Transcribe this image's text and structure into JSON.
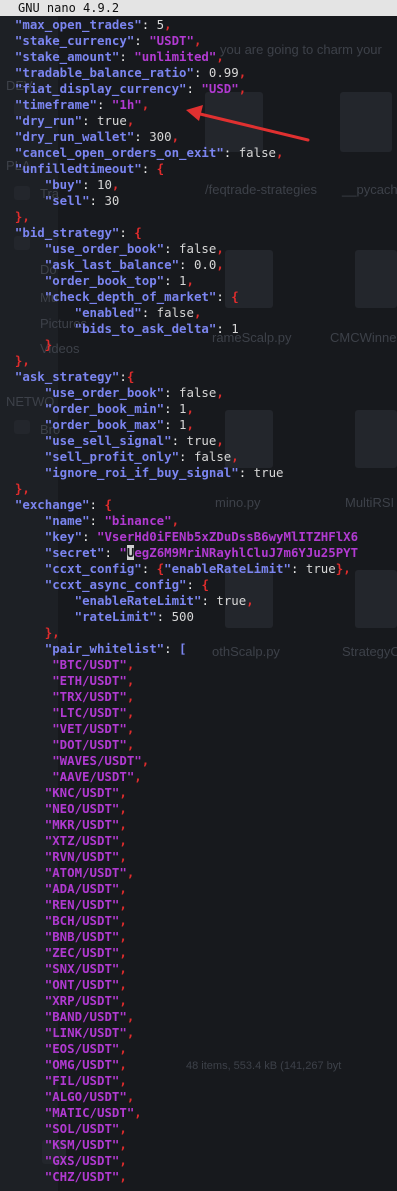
{
  "window": {
    "title": "GNU nano 4.9.2"
  },
  "background_labels": {
    "dev": "DEV",
    "places": "PLA",
    "network": "NETWO",
    "sidebar_items": [
      "Tra",
      "Do",
      "Mu",
      "Pictures",
      "Videos",
      "Bro"
    ],
    "file_names": [
      "/feqtrade-strategies",
      "__pycach",
      "rameScalp.py",
      "CMCWinne",
      "mino.py",
      "MultiRSI",
      "othScalp.py",
      "StrategyC"
    ],
    "status_text": "48 items, 553.4 kB (141,267 byt",
    "banner": "you are going to charm your"
  },
  "annotation": {
    "type": "red-arrow",
    "target": "timeframe line",
    "color": "#e03030"
  },
  "code": {
    "lines": [
      [
        {
          "t": "  "
        },
        {
          "t": "\"max_open_trades\"",
          "c": "k"
        },
        {
          "t": ": ",
          "c": "o"
        },
        {
          "t": "5",
          "c": "v"
        },
        {
          "t": ",",
          "c": "p"
        }
      ],
      [
        {
          "t": "  "
        },
        {
          "t": "\"stake_currency\"",
          "c": "k"
        },
        {
          "t": ": ",
          "c": "o"
        },
        {
          "t": "\"USDT\"",
          "c": "s"
        },
        {
          "t": ",",
          "c": "p"
        }
      ],
      [
        {
          "t": "  "
        },
        {
          "t": "\"stake_amount\"",
          "c": "k"
        },
        {
          "t": ": ",
          "c": "o"
        },
        {
          "t": "\"unlimited\"",
          "c": "s"
        },
        {
          "t": ",",
          "c": "p"
        }
      ],
      [
        {
          "t": "  "
        },
        {
          "t": "\"tradable_balance_ratio\"",
          "c": "k"
        },
        {
          "t": ": ",
          "c": "o"
        },
        {
          "t": "0.99",
          "c": "v"
        },
        {
          "t": ",",
          "c": "p"
        }
      ],
      [
        {
          "t": "  "
        },
        {
          "t": "\"fiat_display_currency\"",
          "c": "k"
        },
        {
          "t": ": ",
          "c": "o"
        },
        {
          "t": "\"USD\"",
          "c": "s"
        },
        {
          "t": ",",
          "c": "p"
        }
      ],
      [
        {
          "t": "  "
        },
        {
          "t": "\"timeframe\"",
          "c": "k"
        },
        {
          "t": ": ",
          "c": "o"
        },
        {
          "t": "\"1h\"",
          "c": "s"
        },
        {
          "t": ",",
          "c": "p"
        }
      ],
      [
        {
          "t": "  "
        },
        {
          "t": "\"dry_run\"",
          "c": "k"
        },
        {
          "t": ": ",
          "c": "o"
        },
        {
          "t": "true",
          "c": "v"
        },
        {
          "t": ",",
          "c": "p"
        }
      ],
      [
        {
          "t": "  "
        },
        {
          "t": "\"dry_run_wallet\"",
          "c": "k"
        },
        {
          "t": ": ",
          "c": "o"
        },
        {
          "t": "300",
          "c": "v"
        },
        {
          "t": ",",
          "c": "p"
        }
      ],
      [
        {
          "t": "  "
        },
        {
          "t": "\"cancel_open_orders_on_exit\"",
          "c": "k"
        },
        {
          "t": ": ",
          "c": "o"
        },
        {
          "t": "false",
          "c": "v"
        },
        {
          "t": ",",
          "c": "p"
        }
      ],
      [
        {
          "t": "  "
        },
        {
          "t": "\"unfilledtimeout\"",
          "c": "k"
        },
        {
          "t": ": ",
          "c": "o"
        },
        {
          "t": "{",
          "c": "p"
        }
      ],
      [
        {
          "t": "      "
        },
        {
          "t": "\"buy\"",
          "c": "k"
        },
        {
          "t": ": ",
          "c": "o"
        },
        {
          "t": "10",
          "c": "v"
        },
        {
          "t": ",",
          "c": "p"
        }
      ],
      [
        {
          "t": "      "
        },
        {
          "t": "\"sell\"",
          "c": "k"
        },
        {
          "t": ": ",
          "c": "o"
        },
        {
          "t": "30",
          "c": "v"
        }
      ],
      [
        {
          "t": "  "
        },
        {
          "t": "},",
          "c": "p"
        }
      ],
      [
        {
          "t": "  "
        },
        {
          "t": "\"bid_strategy\"",
          "c": "k"
        },
        {
          "t": ": ",
          "c": "o"
        },
        {
          "t": "{",
          "c": "p"
        }
      ],
      [
        {
          "t": "      "
        },
        {
          "t": "\"use_order_book\"",
          "c": "k"
        },
        {
          "t": ": ",
          "c": "o"
        },
        {
          "t": "false",
          "c": "v"
        },
        {
          "t": ",",
          "c": "p"
        }
      ],
      [
        {
          "t": "      "
        },
        {
          "t": "\"ask_last_balance\"",
          "c": "k"
        },
        {
          "t": ": ",
          "c": "o"
        },
        {
          "t": "0.0",
          "c": "v"
        },
        {
          "t": ",",
          "c": "p"
        }
      ],
      [
        {
          "t": "      "
        },
        {
          "t": "\"order_book_top\"",
          "c": "k"
        },
        {
          "t": ": ",
          "c": "o"
        },
        {
          "t": "1",
          "c": "v"
        },
        {
          "t": ",",
          "c": "p"
        }
      ],
      [
        {
          "t": "      "
        },
        {
          "t": "\"check_depth_of_market\"",
          "c": "k"
        },
        {
          "t": ": ",
          "c": "o"
        },
        {
          "t": "{",
          "c": "p"
        }
      ],
      [
        {
          "t": "          "
        },
        {
          "t": "\"enabled\"",
          "c": "k"
        },
        {
          "t": ": ",
          "c": "o"
        },
        {
          "t": "false",
          "c": "v"
        },
        {
          "t": ",",
          "c": "p"
        }
      ],
      [
        {
          "t": "          "
        },
        {
          "t": "\"bids_to_ask_delta\"",
          "c": "k"
        },
        {
          "t": ": ",
          "c": "o"
        },
        {
          "t": "1",
          "c": "v"
        }
      ],
      [
        {
          "t": "      "
        },
        {
          "t": "}",
          "c": "p"
        }
      ],
      [
        {
          "t": "  "
        },
        {
          "t": "},",
          "c": "p"
        }
      ],
      [
        {
          "t": "  "
        },
        {
          "t": "\"ask_strategy\"",
          "c": "k"
        },
        {
          "t": ":",
          "c": "o"
        },
        {
          "t": "{",
          "c": "p"
        }
      ],
      [
        {
          "t": "      "
        },
        {
          "t": "\"use_order_book\"",
          "c": "k"
        },
        {
          "t": ": ",
          "c": "o"
        },
        {
          "t": "false",
          "c": "v"
        },
        {
          "t": ",",
          "c": "p"
        }
      ],
      [
        {
          "t": "      "
        },
        {
          "t": "\"order_book_min\"",
          "c": "k"
        },
        {
          "t": ": ",
          "c": "o"
        },
        {
          "t": "1",
          "c": "v"
        },
        {
          "t": ",",
          "c": "p"
        }
      ],
      [
        {
          "t": "      "
        },
        {
          "t": "\"order_book_max\"",
          "c": "k"
        },
        {
          "t": ": ",
          "c": "o"
        },
        {
          "t": "1",
          "c": "v"
        },
        {
          "t": ",",
          "c": "p"
        }
      ],
      [
        {
          "t": "      "
        },
        {
          "t": "\"use_sell_signal\"",
          "c": "k"
        },
        {
          "t": ": ",
          "c": "o"
        },
        {
          "t": "true",
          "c": "v"
        },
        {
          "t": ",",
          "c": "p"
        }
      ],
      [
        {
          "t": "      "
        },
        {
          "t": "\"sell_profit_only\"",
          "c": "k"
        },
        {
          "t": ": ",
          "c": "o"
        },
        {
          "t": "false",
          "c": "v"
        },
        {
          "t": ",",
          "c": "p"
        }
      ],
      [
        {
          "t": "      "
        },
        {
          "t": "\"ignore_roi_if_buy_signal\"",
          "c": "k"
        },
        {
          "t": ": ",
          "c": "o"
        },
        {
          "t": "true",
          "c": "v"
        }
      ],
      [
        {
          "t": "  "
        },
        {
          "t": "},",
          "c": "p"
        }
      ],
      [
        {
          "t": "  "
        },
        {
          "t": "\"exchange\"",
          "c": "k"
        },
        {
          "t": ": ",
          "c": "o"
        },
        {
          "t": "{",
          "c": "p"
        }
      ],
      [
        {
          "t": "      "
        },
        {
          "t": "\"name\"",
          "c": "k"
        },
        {
          "t": ": ",
          "c": "o"
        },
        {
          "t": "\"binance\"",
          "c": "s"
        },
        {
          "t": ",",
          "c": "p"
        }
      ],
      [
        {
          "t": "      "
        },
        {
          "t": "\"key\"",
          "c": "k"
        },
        {
          "t": ": ",
          "c": "o"
        },
        {
          "t": "\"VserHd0iFENb5xZDuDssB6wyMlITZHFlX6",
          "c": "s"
        }
      ],
      [
        {
          "t": "      "
        },
        {
          "t": "\"secret\"",
          "c": "k"
        },
        {
          "t": ": ",
          "c": "o"
        },
        {
          "t": "\"",
          "c": "s"
        },
        {
          "t": "U",
          "c": "s",
          "hl": true
        },
        {
          "t": "egZ6M9MriNRayhlCluJ7m6YJu25PYT",
          "c": "s"
        }
      ],
      [
        {
          "t": "      "
        },
        {
          "t": "\"ccxt_config\"",
          "c": "k"
        },
        {
          "t": ": ",
          "c": "o"
        },
        {
          "t": "{",
          "c": "p"
        },
        {
          "t": "\"enableRateLimit\"",
          "c": "k"
        },
        {
          "t": ": ",
          "c": "o"
        },
        {
          "t": "true",
          "c": "v"
        },
        {
          "t": "},",
          "c": "p"
        }
      ],
      [
        {
          "t": "      "
        },
        {
          "t": "\"ccxt_async_config\"",
          "c": "k"
        },
        {
          "t": ": ",
          "c": "o"
        },
        {
          "t": "{",
          "c": "p"
        }
      ],
      [
        {
          "t": "          "
        },
        {
          "t": "\"enableRateLimit\"",
          "c": "k"
        },
        {
          "t": ": ",
          "c": "o"
        },
        {
          "t": "true",
          "c": "v"
        },
        {
          "t": ",",
          "c": "p"
        }
      ],
      [
        {
          "t": "          "
        },
        {
          "t": "\"rateLimit\"",
          "c": "k"
        },
        {
          "t": ": ",
          "c": "o"
        },
        {
          "t": "500",
          "c": "v"
        }
      ],
      [
        {
          "t": "      "
        },
        {
          "t": "},",
          "c": "p"
        }
      ],
      [
        {
          "t": "      "
        },
        {
          "t": "\"pair_whitelist\"",
          "c": "k"
        },
        {
          "t": ": ",
          "c": "o"
        },
        {
          "t": "[",
          "c": "k"
        }
      ],
      [
        {
          "t": "       "
        },
        {
          "t": "\"BTC/USDT\"",
          "c": "s"
        },
        {
          "t": ",",
          "c": "p"
        }
      ],
      [
        {
          "t": "       "
        },
        {
          "t": "\"ETH/USDT\"",
          "c": "s"
        },
        {
          "t": ",",
          "c": "p"
        }
      ],
      [
        {
          "t": "       "
        },
        {
          "t": "\"TRX/USDT\"",
          "c": "s"
        },
        {
          "t": ",",
          "c": "p"
        }
      ],
      [
        {
          "t": "       "
        },
        {
          "t": "\"LTC/USDT\"",
          "c": "s"
        },
        {
          "t": ",",
          "c": "p"
        }
      ],
      [
        {
          "t": "       "
        },
        {
          "t": "\"VET/USDT\"",
          "c": "s"
        },
        {
          "t": ",",
          "c": "p"
        }
      ],
      [
        {
          "t": "       "
        },
        {
          "t": "\"DOT/USDT\"",
          "c": "s"
        },
        {
          "t": ",",
          "c": "p"
        }
      ],
      [
        {
          "t": "       "
        },
        {
          "t": "\"WAVES/USDT\"",
          "c": "s"
        },
        {
          "t": ",",
          "c": "p"
        }
      ],
      [
        {
          "t": "       "
        },
        {
          "t": "\"AAVE/USDT\"",
          "c": "s"
        },
        {
          "t": ",",
          "c": "p"
        }
      ],
      [
        {
          "t": "      "
        },
        {
          "t": "\"KNC/USDT\"",
          "c": "s"
        },
        {
          "t": ",",
          "c": "p"
        }
      ],
      [
        {
          "t": "      "
        },
        {
          "t": "\"NEO/USDT\"",
          "c": "s"
        },
        {
          "t": ",",
          "c": "p"
        }
      ],
      [
        {
          "t": "      "
        },
        {
          "t": "\"MKR/USDT\"",
          "c": "s"
        },
        {
          "t": ",",
          "c": "p"
        }
      ],
      [
        {
          "t": "      "
        },
        {
          "t": "\"XTZ/USDT\"",
          "c": "s"
        },
        {
          "t": ",",
          "c": "p"
        }
      ],
      [
        {
          "t": "      "
        },
        {
          "t": "\"RVN/USDT\"",
          "c": "s"
        },
        {
          "t": ",",
          "c": "p"
        }
      ],
      [
        {
          "t": "      "
        },
        {
          "t": "\"ATOM/USDT\"",
          "c": "s"
        },
        {
          "t": ",",
          "c": "p"
        }
      ],
      [
        {
          "t": "      "
        },
        {
          "t": "\"ADA/USDT\"",
          "c": "s"
        },
        {
          "t": ",",
          "c": "p"
        }
      ],
      [
        {
          "t": "      "
        },
        {
          "t": "\"REN/USDT\"",
          "c": "s"
        },
        {
          "t": ",",
          "c": "p"
        }
      ],
      [
        {
          "t": "      "
        },
        {
          "t": "\"BCH/USDT\"",
          "c": "s"
        },
        {
          "t": ",",
          "c": "p"
        }
      ],
      [
        {
          "t": "      "
        },
        {
          "t": "\"BNB/USDT\"",
          "c": "s"
        },
        {
          "t": ",",
          "c": "p"
        }
      ],
      [
        {
          "t": "      "
        },
        {
          "t": "\"ZEC/USDT\"",
          "c": "s"
        },
        {
          "t": ",",
          "c": "p"
        }
      ],
      [
        {
          "t": "      "
        },
        {
          "t": "\"SNX/USDT\"",
          "c": "s"
        },
        {
          "t": ",",
          "c": "p"
        }
      ],
      [
        {
          "t": "      "
        },
        {
          "t": "\"ONT/USDT\"",
          "c": "s"
        },
        {
          "t": ",",
          "c": "p"
        }
      ],
      [
        {
          "t": "      "
        },
        {
          "t": "\"XRP/USDT\"",
          "c": "s"
        },
        {
          "t": ",",
          "c": "p"
        }
      ],
      [
        {
          "t": "      "
        },
        {
          "t": "\"BAND/USDT\"",
          "c": "s"
        },
        {
          "t": ",",
          "c": "p"
        }
      ],
      [
        {
          "t": "      "
        },
        {
          "t": "\"LINK/USDT\"",
          "c": "s"
        },
        {
          "t": ",",
          "c": "p"
        }
      ],
      [
        {
          "t": "      "
        },
        {
          "t": "\"EOS/USDT\"",
          "c": "s"
        },
        {
          "t": ",",
          "c": "p"
        }
      ],
      [
        {
          "t": "      "
        },
        {
          "t": "\"OMG/USDT\"",
          "c": "s"
        },
        {
          "t": ",",
          "c": "p"
        }
      ],
      [
        {
          "t": "      "
        },
        {
          "t": "\"FIL/USDT\"",
          "c": "s"
        },
        {
          "t": ",",
          "c": "p"
        }
      ],
      [
        {
          "t": "      "
        },
        {
          "t": "\"ALGO/USDT\"",
          "c": "s"
        },
        {
          "t": ",",
          "c": "p"
        }
      ],
      [
        {
          "t": "      "
        },
        {
          "t": "\"MATIC/USDT\"",
          "c": "s"
        },
        {
          "t": ",",
          "c": "p"
        }
      ],
      [
        {
          "t": "      "
        },
        {
          "t": "\"SOL/USDT\"",
          "c": "s"
        },
        {
          "t": ",",
          "c": "p"
        }
      ],
      [
        {
          "t": "      "
        },
        {
          "t": "\"KSM/USDT\"",
          "c": "s"
        },
        {
          "t": ",",
          "c": "p"
        }
      ],
      [
        {
          "t": "      "
        },
        {
          "t": "\"GXS/USDT\"",
          "c": "s"
        },
        {
          "t": ",",
          "c": "p"
        }
      ],
      [
        {
          "t": "      "
        },
        {
          "t": "\"CHZ/USDT\"",
          "c": "s"
        },
        {
          "t": ",",
          "c": "p"
        }
      ]
    ]
  }
}
